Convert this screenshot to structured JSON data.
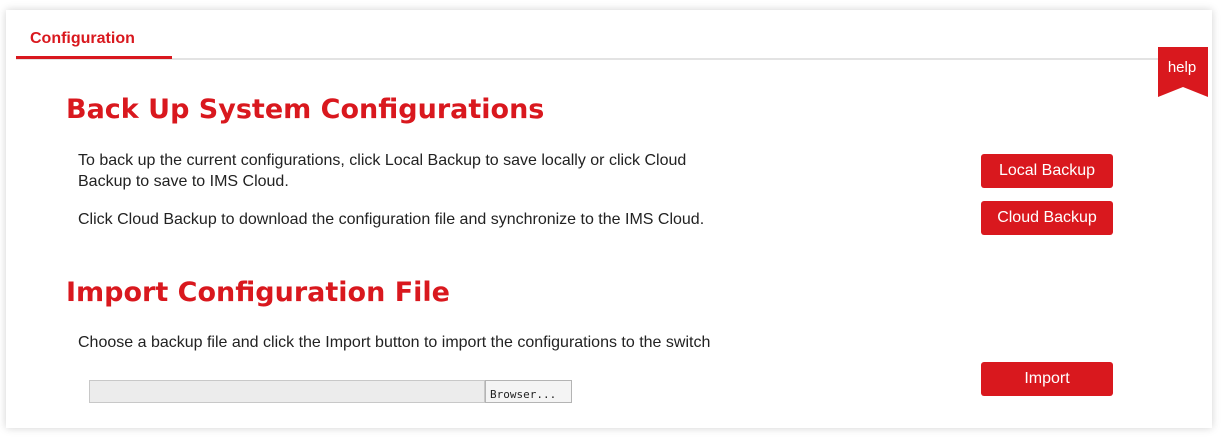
{
  "tab": {
    "label": "Configuration"
  },
  "help": {
    "label": "help"
  },
  "backup": {
    "title": "Back Up System Configurations",
    "desc_line1": "To back up the current configurations, click Local Backup to save locally or click Cloud",
    "desc_line2": "Backup to save to IMS Cloud.",
    "desc_cloud": "Click Cloud Backup to download the configuration file and synchronize to the IMS Cloud.",
    "local_button": "Local Backup",
    "cloud_button": "Cloud Backup"
  },
  "import": {
    "title": "Import Configuration File",
    "desc": "Choose a backup file and click the Import button to import the configurations to the switch",
    "browse_button": "Browser...",
    "import_button": "Import"
  },
  "colors": {
    "accent": "#d9181e"
  }
}
